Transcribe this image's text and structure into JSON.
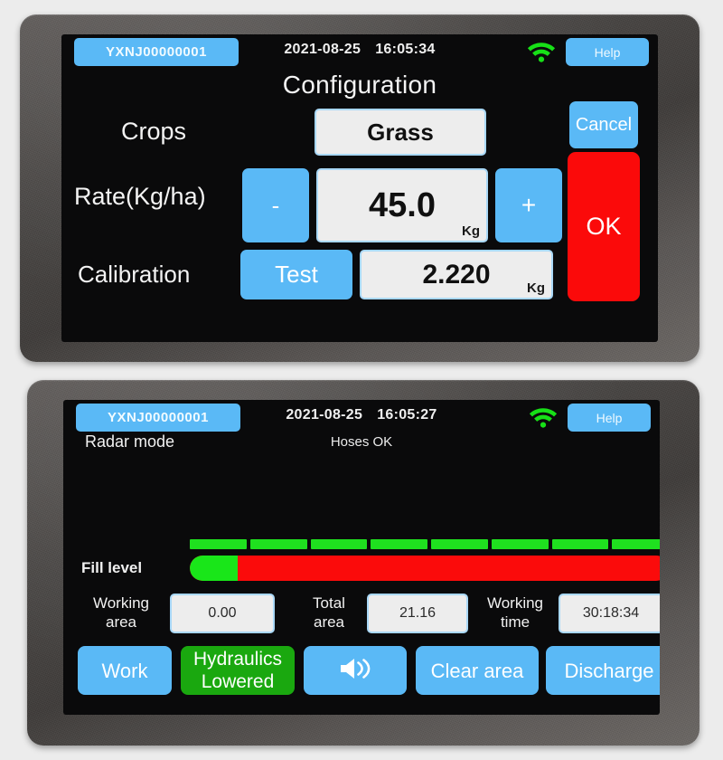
{
  "theme": {
    "page_bg": "#ececec",
    "bezel": "#494644",
    "screen_bg": "#0a0a0b",
    "accent_blue": "#5ab9f6",
    "danger_red": "#fb0a0a",
    "ok_green": "#1aa80f",
    "bar_green": "#19e619",
    "bar_red": "#fb0b0b"
  },
  "top_panel": {
    "statusbar": {
      "device_id": "YXNJ00000001",
      "date": "2021-08-25",
      "time": "16:05:34",
      "wifi_icon": "wifi-icon",
      "help_label": "Help"
    },
    "title": "Configuration",
    "rows": {
      "crops": {
        "label": "Crops",
        "value": "Grass"
      },
      "rate": {
        "label": "Rate(Kg/ha)",
        "decrement_label": "-",
        "increment_label": "+",
        "value": "45.0",
        "unit": "Kg"
      },
      "calibration": {
        "label": "Calibration",
        "test_label": "Test",
        "value": "2.220",
        "unit": "Kg"
      }
    },
    "actions": {
      "cancel_label": "Cancel",
      "ok_label": "OK"
    }
  },
  "bottom_panel": {
    "statusbar": {
      "device_id": "YXNJ00000001",
      "date": "2021-08-25",
      "time": "16:05:27",
      "wifi_icon": "wifi-icon",
      "help_label": "Help"
    },
    "mode_text": "Radar mode",
    "hoses_status": "Hoses OK",
    "fill_level": {
      "label": "Fill level",
      "percent": 10,
      "segment_count": 8
    },
    "stats": [
      {
        "label_line1": "Working",
        "label_line2": "area",
        "value": "0.00"
      },
      {
        "label_line1": "Total",
        "label_line2": "area",
        "value": "21.16"
      },
      {
        "label_line1": "Working",
        "label_line2": "time",
        "value": "30:18:34"
      }
    ],
    "buttons": {
      "work_label": "Work",
      "hydraulics_line1": "Hydraulics",
      "hydraulics_line2": "Lowered",
      "speaker_icon": "speaker-volume-icon",
      "clear_area_label": "Clear area",
      "discharge_label": "Discharge"
    }
  }
}
